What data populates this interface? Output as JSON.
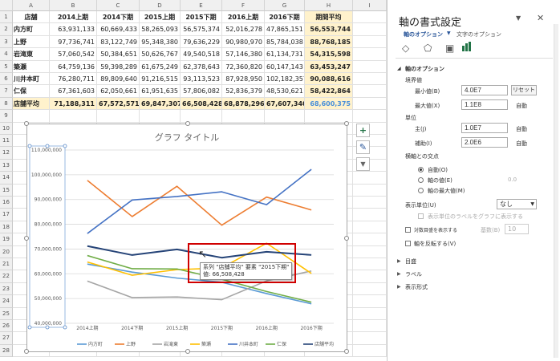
{
  "sheet": {
    "columns": [
      "A",
      "B",
      "C",
      "D",
      "E",
      "F",
      "G",
      "H",
      "I"
    ],
    "rows": [
      "1",
      "2",
      "3",
      "4",
      "5",
      "6",
      "7",
      "8",
      "9",
      "10",
      "11",
      "12",
      "13",
      "14",
      "15",
      "16",
      "17",
      "18",
      "19",
      "20",
      "21",
      "22",
      "23",
      "24",
      "25",
      "26",
      "27",
      "28"
    ],
    "header": [
      "店舗",
      "2014上期",
      "2014下期",
      "2015上期",
      "2015下期",
      "2016上期",
      "2016下期",
      "期間平均"
    ],
    "data": [
      [
        "内方町",
        "63,931,133",
        "60,669,433",
        "58,265,093",
        "56,575,374",
        "52,016,278",
        "47,865,151",
        "56,553,744"
      ],
      [
        "上野",
        "97,736,741",
        "83,122,749",
        "95,348,380",
        "79,636,229",
        "90,980,970",
        "85,784,038",
        "88,768,185"
      ],
      [
        "岩滝東",
        "57,060,542",
        "50,384,651",
        "50,626,767",
        "49,540,518",
        "57,146,380",
        "61,134,731",
        "54,315,598"
      ],
      [
        "築瀬",
        "64,759,136",
        "59,398,289",
        "61,675,249",
        "62,378,643",
        "72,360,820",
        "60,147,143",
        "63,453,247"
      ],
      [
        "川井本町",
        "76,280,711",
        "89,809,640",
        "91,216,515",
        "93,113,523",
        "87,928,950",
        "102,182,357",
        "90,088,616"
      ],
      [
        "仁保",
        "67,361,603",
        "62,050,661",
        "61,951,635",
        "57,806,082",
        "52,836,379",
        "48,530,621",
        "58,422,864"
      ],
      [
        "店舗平均",
        "71,188,311",
        "67,572,571",
        "69,847,307",
        "66,508,428",
        "68,878,296",
        "67,607,340",
        "68,600,375"
      ]
    ]
  },
  "chart": {
    "title": "グラフ タイトル",
    "tooltip": {
      "line1": "系列 \"店舗平均\" 要素 \"2015下期\"",
      "line2": "値: 66,508,428"
    },
    "buttons": {
      "plus": "+",
      "brush": "✎",
      "filter": "▼"
    }
  },
  "chart_data": {
    "type": "line",
    "categories": [
      "2014上期",
      "2014下期",
      "2015上期",
      "2015下期",
      "2016上期",
      "2016下期"
    ],
    "ylim": [
      40000000,
      110000000
    ],
    "yticks": [
      "40,000,000",
      "50,000,000",
      "60,000,000",
      "70,000,000",
      "80,000,000",
      "90,000,000",
      "100,000,000",
      "110,000,000"
    ],
    "ytick_values": [
      40000000,
      50000000,
      60000000,
      70000000,
      80000000,
      90000000,
      100000000,
      110000000
    ],
    "grid": true,
    "legend_position": "bottom",
    "series": [
      {
        "name": "内方町",
        "color": "#5b9bd5",
        "values": [
          63931133,
          60669433,
          58265093,
          56575374,
          52016278,
          47865151
        ]
      },
      {
        "name": "上野",
        "color": "#ed7d31",
        "values": [
          97736741,
          83122749,
          95348380,
          79636229,
          90980970,
          85784038
        ]
      },
      {
        "name": "岩滝東",
        "color": "#a5a5a5",
        "values": [
          57060542,
          50384651,
          50626767,
          49540518,
          57146380,
          61134731
        ]
      },
      {
        "name": "築瀬",
        "color": "#ffc000",
        "values": [
          64759136,
          59398289,
          61675249,
          62378643,
          72360820,
          60147143
        ]
      },
      {
        "name": "川井本町",
        "color": "#4472c4",
        "values": [
          76280711,
          89809640,
          91216515,
          93113523,
          87928950,
          102182357
        ]
      },
      {
        "name": "仁保",
        "color": "#70ad47",
        "values": [
          67361603,
          62050661,
          61951635,
          57806082,
          52836379,
          48530621
        ]
      },
      {
        "name": "店舗平均",
        "color": "#264478",
        "values": [
          71188311,
          67572571,
          69847307,
          66508428,
          68878296,
          67607340
        ]
      }
    ]
  },
  "panel": {
    "title": "軸の書式設定",
    "tab_axis": "軸のオプション",
    "tab_text": "文字のオプション",
    "section_axis": "軸のオプション",
    "bounds": "境界値",
    "min_label": "最小値(B)",
    "min_value": "4.0E7",
    "min_btn": "リセット",
    "max_label": "最大値(X)",
    "max_value": "1.1E8",
    "max_btn": "自動",
    "units": "単位",
    "major_label": "主(J)",
    "major_value": "1.0E7",
    "major_btn": "自動",
    "minor_label": "補助(I)",
    "minor_value": "2.0E6",
    "minor_btn": "自動",
    "cross": "横軸との交点",
    "cross_auto": "自動(O)",
    "cross_value": "軸の値(E)",
    "cross_value_num": "0.0",
    "cross_max": "軸の最大値(M)",
    "display_units": "表示単位(U)",
    "display_units_value": "なし",
    "show_label": "表示単位のラベルをグラフに表示する",
    "log_scale": "対数目盛を表示する",
    "log_base_label": "基数(B)",
    "log_base_value": "10",
    "reverse": "軸を反転する(V)",
    "tick_marks": "目盛",
    "labels": "ラベル",
    "number": "表示形式"
  }
}
